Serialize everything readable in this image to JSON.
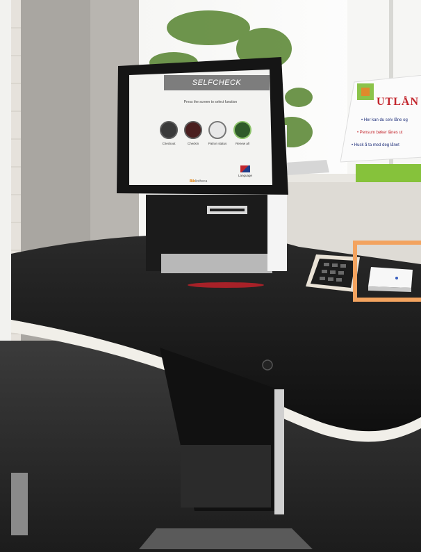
{
  "kiosk": {
    "header": "SELFCHECK",
    "instruction": "Press the screen to select function",
    "functions": [
      {
        "label": "Checkout",
        "icon": "book-checkout-icon"
      },
      {
        "label": "Checkin",
        "icon": "book-return-icon"
      },
      {
        "label": "Patron status",
        "icon": "patron-card-icon"
      },
      {
        "label": "Renew all",
        "icon": "renew-icon"
      }
    ],
    "brand_prefix": "Bib",
    "brand_suffix": "liotheca",
    "language_label": "Language",
    "brand_color": "#e07b00"
  },
  "poster": {
    "title": "UTLÅN",
    "lines": [
      {
        "text": "• Her kan du selv låne og",
        "color": "#1f2f7a"
      },
      {
        "text": "• Pensum bøker lånes ut",
        "color": "#c3262d"
      },
      {
        "text": "• Husk å ta med deg lånet",
        "color": "#1f2f7a"
      }
    ]
  },
  "highlight": {
    "color": "#f3a35f",
    "target": "card-reader"
  }
}
